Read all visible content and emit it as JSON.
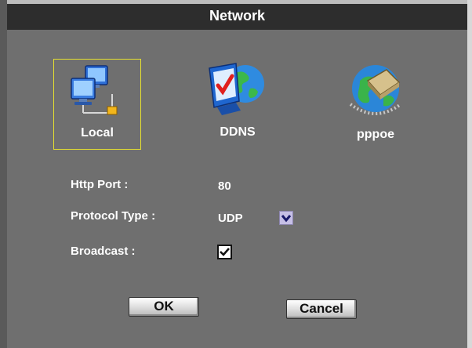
{
  "window": {
    "title": "Network"
  },
  "nav": {
    "items": [
      {
        "label": "Local",
        "icon": "local-network-icon",
        "selected": true
      },
      {
        "label": "DDNS",
        "icon": "ddns-monitor-globe-icon",
        "selected": false
      },
      {
        "label": "pppoe",
        "icon": "pppoe-globe-modem-icon",
        "selected": false
      }
    ]
  },
  "form": {
    "http_port": {
      "label": "Http Port :",
      "value": "80"
    },
    "protocol_type": {
      "label": "Protocol Type :",
      "value": "UDP"
    },
    "broadcast": {
      "label": "Broadcast :",
      "checked": true
    }
  },
  "buttons": {
    "ok": "OK",
    "cancel": "Cancel"
  },
  "colors": {
    "titlebar": "#2d2d2d",
    "panel": "#6f6f6f",
    "selection_border": "#e6e030",
    "dropdown_button": "#c6bfe6"
  }
}
